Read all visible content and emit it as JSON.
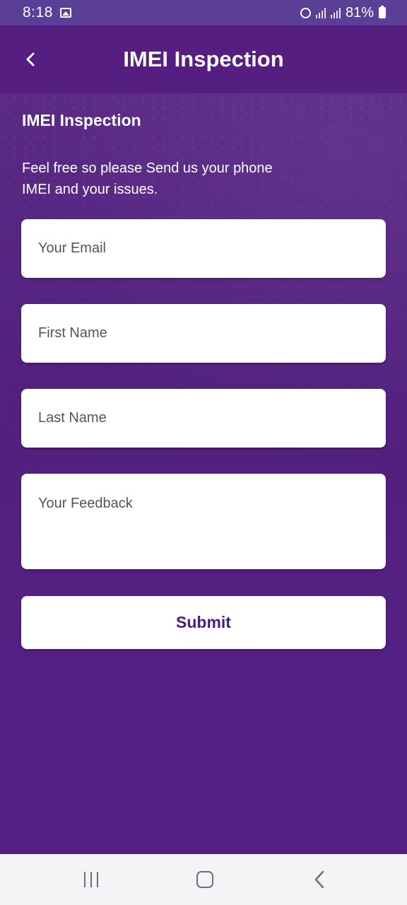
{
  "status_bar": {
    "time": "8:18",
    "battery": "81%",
    "icons": [
      "gallery-icon",
      "alarm-icon",
      "signal-icon",
      "signal-icon",
      "battery-icon"
    ]
  },
  "app_bar": {
    "title": "IMEI Inspection",
    "back_icon": "chevron-left-icon"
  },
  "form": {
    "heading": "IMEI Inspection",
    "description": "Feel free so please Send us your phone IMEI and your issues.",
    "fields": {
      "email": {
        "placeholder": "Your Email",
        "value": ""
      },
      "first_name": {
        "placeholder": "First Name",
        "value": ""
      },
      "last_name": {
        "placeholder": "Last Name",
        "value": ""
      },
      "feedback": {
        "placeholder": "Your Feedback",
        "value": ""
      }
    },
    "submit_label": "Submit"
  },
  "nav_bar": {
    "buttons": [
      "recents-icon",
      "home-icon",
      "back-icon"
    ]
  },
  "colors": {
    "primary": "#561e80",
    "status_bar": "#5b3e96",
    "submit_text": "#4b1d7a",
    "nav_bar": "#f4f3f5"
  }
}
